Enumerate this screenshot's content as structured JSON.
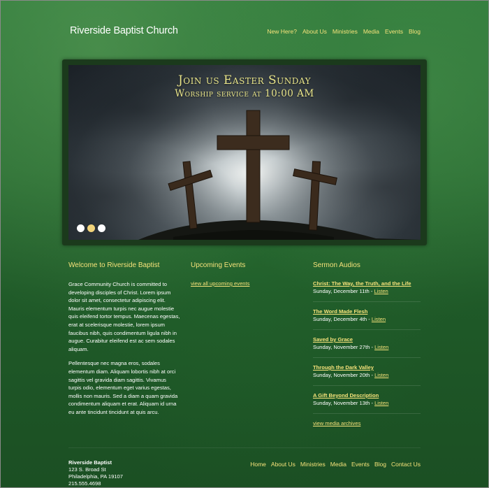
{
  "header": {
    "site_title": "Riverside Baptist Church",
    "nav": [
      "New Here?",
      "About Us",
      "Ministries",
      "Media",
      "Events",
      "Blog"
    ]
  },
  "hero": {
    "line1": "Join us Easter Sunday",
    "line2": "Worship service at 10:00 AM",
    "slides": 3,
    "active_slide": 2
  },
  "welcome": {
    "heading": "Welcome to Riverside Baptist",
    "paragraphs": [
      "Grace Community Church is committed to developing disciples of Christ. Lorem ipsum dolor sit amet, consectetur adipiscing elit. Mauris elementum turpis nec augue molestie quis eleifend tortor tempus. Maecenas egestas, erat at scelerisque molestie, lorem ipsum faucibus nibh, quis condimentum ligula nibh in augue. Curabitur eleifend est ac sem sodales aliquam.",
      "Pellentesque nec magna eros, sodales elementum diam. Aliquam lobortis nibh at orci sagittis vel gravida diam sagittis. Vivamus turpis odio, elementum eget varius egestas, mollis non mauris. Sed a diam a quam gravida condimentum aliquam et erat. Aliquam id urna eu ante tincidunt tincidunt at quis arcu."
    ]
  },
  "events": {
    "heading": "Upcoming Events",
    "link": "view all upcoming events"
  },
  "sermons": {
    "heading": "Sermon Audios",
    "items": [
      {
        "title": "Christ: The Way, the Truth, and the Life",
        "date": "Sunday, December 11th - ",
        "link": "Listen"
      },
      {
        "title": "The Word Made Flesh",
        "date": "Sunday, December 4th - ",
        "link": "Listen"
      },
      {
        "title": "Saved by Grace",
        "date": "Sunday, November 27th - ",
        "link": "Listen"
      },
      {
        "title": "Through the Dark Valley",
        "date": "Sunday, November 20th - ",
        "link": "Listen"
      },
      {
        "title": "A Gift Beyond Description",
        "date": "Sunday, November 13th - ",
        "link": "Listen"
      }
    ],
    "archive_link": "view media archives"
  },
  "footer": {
    "name": "Riverside Baptist",
    "address1": "123 S. Broad St",
    "address2": "Philadelphia, PA 19107",
    "phone": "215.555.4698",
    "nav": [
      "Home",
      "About Us",
      "Ministries",
      "Media",
      "Events",
      "Blog",
      "Contact Us"
    ]
  },
  "colors": {
    "accent": "#f6e27a",
    "background": "#2a6e33"
  }
}
